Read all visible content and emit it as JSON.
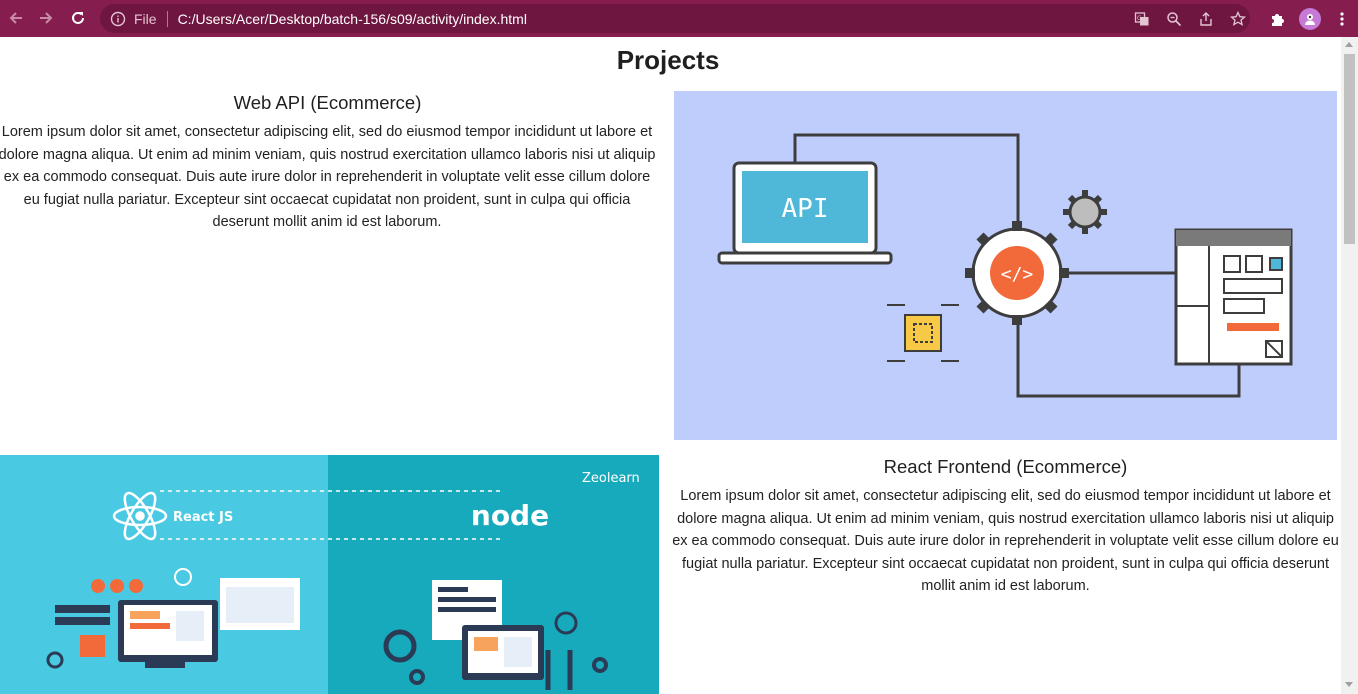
{
  "browser": {
    "file_label": "File",
    "url": "C:/Users/Acer/Desktop/batch-156/s09/activity/index.html",
    "colors": {
      "toolbar": "#861d4f",
      "omnibox": "#6f1640"
    }
  },
  "page": {
    "title": "Projects",
    "projects": [
      {
        "title": "Web API (Ecommerce)",
        "description": "Lorem ipsum dolor sit amet, consectetur adipiscing elit, sed do eiusmod tempor incididunt ut labore et dolore magna aliqua. Ut enim ad minim veniam, quis nostrud exercitation ullamco laboris nisi ut aliquip ex ea commodo consequat. Duis aute irure dolor in reprehenderit in voluptate velit esse cillum dolore eu fugiat nulla pariatur. Excepteur sint occaecat cupidatat non proident, sunt in culpa qui officia deserunt mollit anim id est laborum.",
        "image_label": "API"
      },
      {
        "title": "React Frontend (Ecommerce)",
        "description": "Lorem ipsum dolor sit amet, consectetur adipiscing elit, sed do eiusmod tempor incididunt ut labore et dolore magna aliqua. Ut enim ad minim veniam, quis nostrud exercitation ullamco laboris nisi ut aliquip ex ea commodo consequat. Duis aute irure dolor in reprehenderit in voluptate velit esse cillum dolore eu fugiat nulla pariatur. Excepteur sint occaecat cupidatat non proident, sunt in culpa qui officia deserunt mollit anim id est laborum.",
        "image_labels": {
          "react": "React JS",
          "node": "node",
          "brand": "Zeolearn"
        }
      }
    ]
  }
}
